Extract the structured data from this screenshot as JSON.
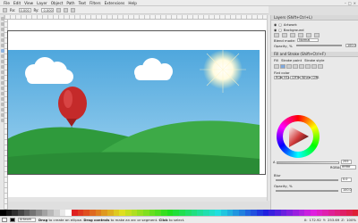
{
  "menu": [
    "File",
    "Edit",
    "View",
    "Layer",
    "Object",
    "Path",
    "Text",
    "Filters",
    "Extensions",
    "Help"
  ],
  "tool_controls": {
    "rx_label": "Rx:",
    "rx_value": "0.000",
    "ry_label": "Ry:",
    "ry_value": "0.000"
  },
  "layers_panel": {
    "title": "Layers (Shift+Ctrl+L)",
    "layers": [
      "Artwork",
      "Background"
    ],
    "blend_label": "Blend mode:",
    "blend_value": "Normal",
    "opacity_label": "Opacity, %",
    "opacity_value": "100.0"
  },
  "fill_stroke": {
    "title": "Fill and Stroke (Shift+Ctrl+F)",
    "tabs": [
      "Fill",
      "Stroke paint",
      "Stroke style"
    ],
    "flat_label": "Flat color",
    "color_tabs": [
      "RGB",
      "HSL",
      "CMYK",
      "Wheel",
      "CMS"
    ],
    "a_label": "A",
    "a_value": "255",
    "rgba_label": "RGBA:",
    "rgba_value": "ffffffff",
    "blur_label": "Blur",
    "blur_value": "0.0",
    "opacity_label": "Opacity, %",
    "opacity_value": "100.0"
  },
  "status": {
    "layer": "Artwork",
    "message_bold": "Drag",
    "message1": " to create an ellipse. ",
    "message_bold2": "Drag controls",
    "message2": " to make an arc or segment. ",
    "message_bold3": "Click",
    "message3": " to select.",
    "coords_x_label": "X:",
    "coords_x": "172.92",
    "coords_y_label": "Y:",
    "coords_y": "253.69",
    "zoom_label": "Z:",
    "zoom": "100%"
  },
  "colors": {
    "sky": "#5fb7e6",
    "hill_dark": "#2f9a3c",
    "hill_light": "#3daa47",
    "balloon": "#c42a2a",
    "accent": "#3a7bd5"
  }
}
